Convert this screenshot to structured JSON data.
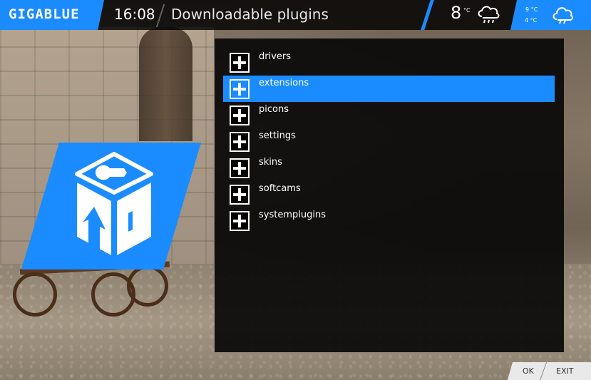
{
  "header": {
    "brand": "GIGABLUE",
    "time": "16:08",
    "title": "Downloadable plugins"
  },
  "weather": {
    "current_temp": "8",
    "current_unit": "°C",
    "current_icon": "rain-cloud-icon",
    "forecast_high": "9 °C",
    "forecast_low": "4 °C",
    "forecast_icon": "cloud-icon"
  },
  "plugins": {
    "items": [
      {
        "label": "drivers"
      },
      {
        "label": "extensions"
      },
      {
        "label": "picons"
      },
      {
        "label": "settings"
      },
      {
        "label": "skins"
      },
      {
        "label": "softcams"
      },
      {
        "label": "systemplugins"
      }
    ],
    "selected_index": 1
  },
  "keys": {
    "ok_label": "OK",
    "exit_label": "EXIT"
  },
  "colors": {
    "accent": "#1a8cff",
    "panel": "#080808",
    "text": "#ffffff"
  }
}
